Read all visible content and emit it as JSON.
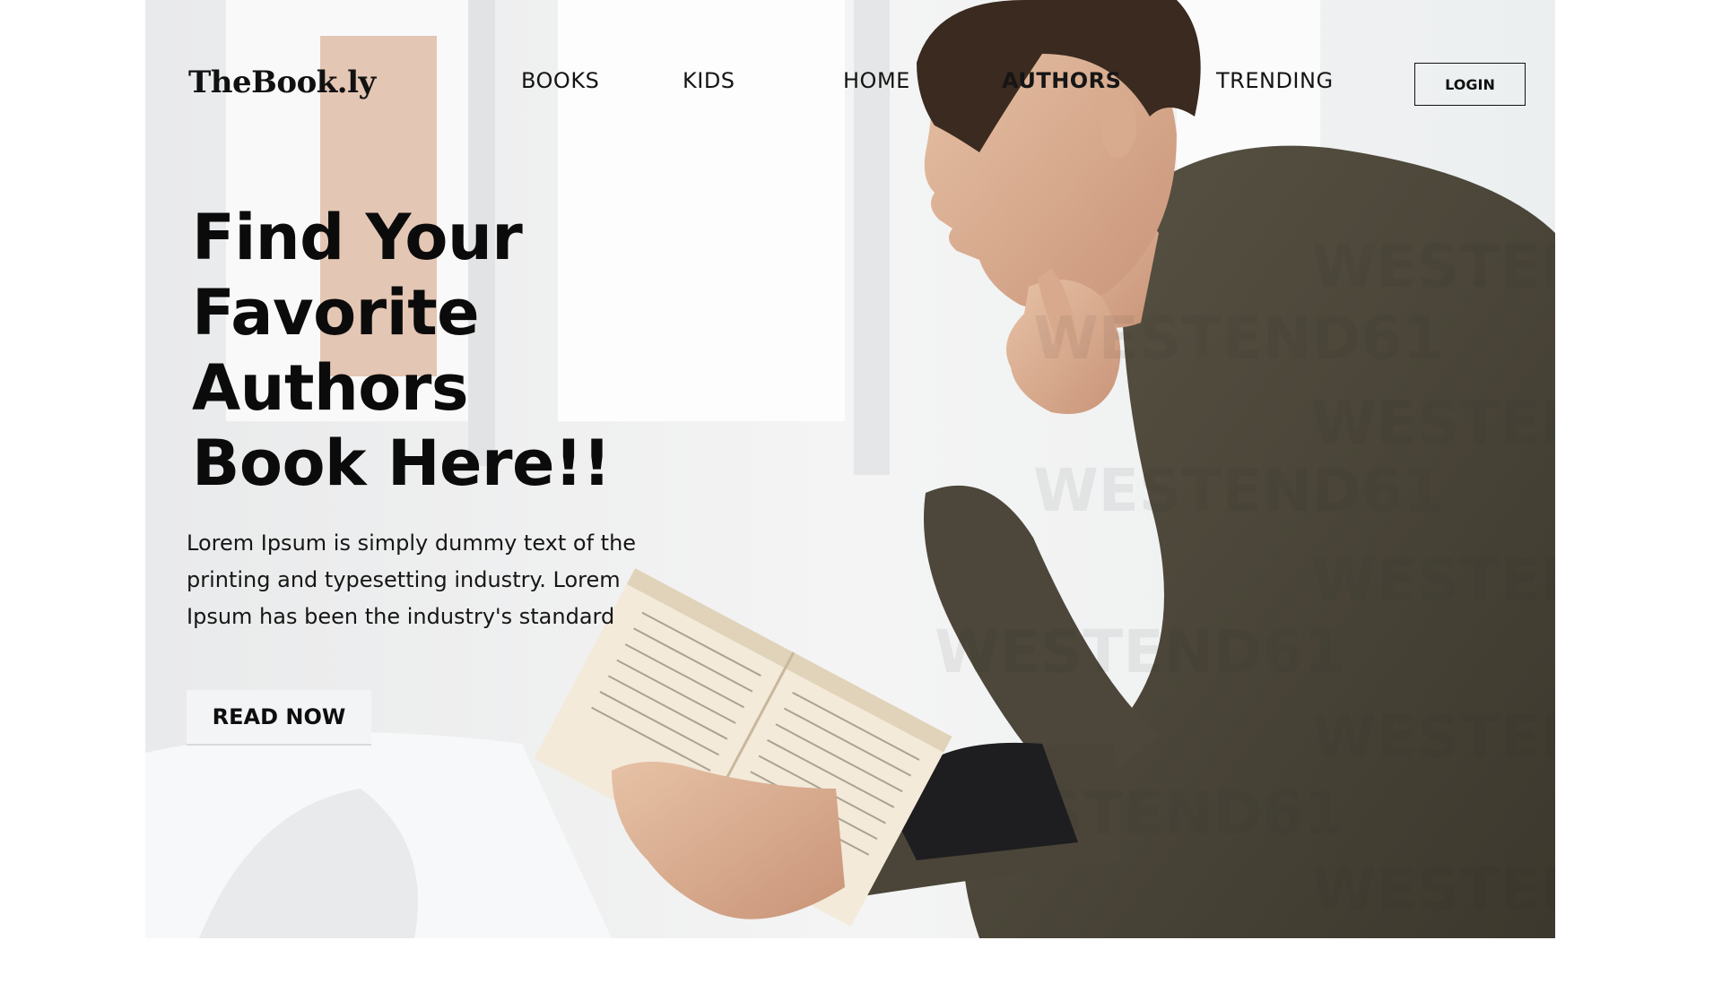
{
  "brand": {
    "logo_text": "TheBook.ly"
  },
  "nav": {
    "items": [
      {
        "label": "BOOKS"
      },
      {
        "label": "KIDS"
      },
      {
        "label": "HOME"
      },
      {
        "label": "AUTHORS",
        "active": true
      },
      {
        "label": "TRENDING"
      }
    ],
    "login_label": "LOGIN"
  },
  "hero": {
    "headline_lines": [
      "Find Your",
      "Favorite",
      "Authors",
      "Book Here!!"
    ],
    "description_lines": [
      "Lorem Ipsum is simply dummy text of the",
      "printing and typesetting industry. Lorem",
      "Ipsum has been the industry's standard"
    ],
    "cta_label": "READ NOW",
    "watermark_text": "WESTEND61"
  },
  "colors": {
    "text": "#111111",
    "shirt": "#4a4537",
    "background": "#eef0f1"
  }
}
